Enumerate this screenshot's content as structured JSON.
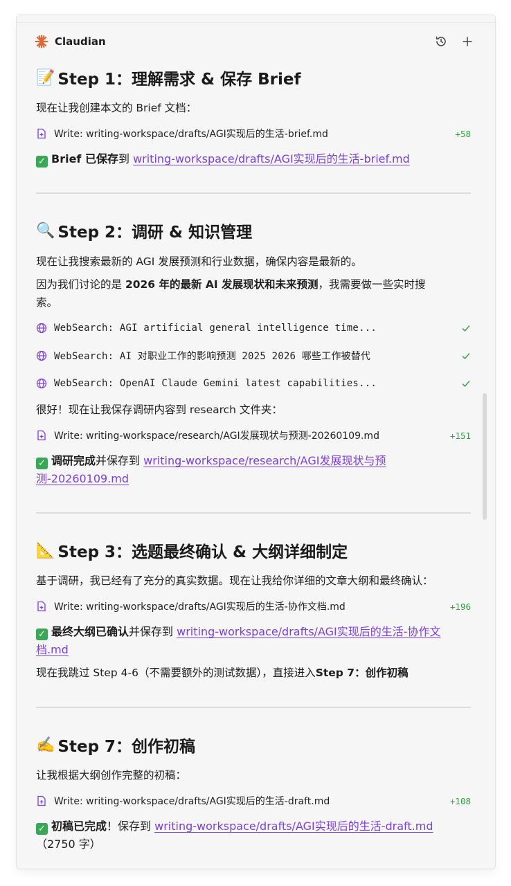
{
  "app": {
    "title": "Claudian"
  },
  "colors": {
    "accent_link": "#7b3fd6",
    "success": "#2fa043",
    "brand": "#d96a3b"
  },
  "icons": {
    "brand": "sunburst-icon",
    "history": "history-icon",
    "new": "plus-icon",
    "write": "file-plus-icon",
    "search": "globe-icon",
    "success": "check-icon"
  },
  "step1": {
    "emoji": "📝",
    "heading": "Step 1：理解需求 & 保存 Brief",
    "intro": "现在让我创建本文的 Brief 文档：",
    "tool": {
      "label": "Write: writing-workspace/drafts/AGI实现后的生活-brief.md",
      "stat": "+58"
    },
    "done_bold": "Brief 已保存",
    "done_text": "到 ",
    "done_link": "writing-workspace/drafts/AGI实现后的生活-brief.md"
  },
  "step2": {
    "emoji": "🔍",
    "heading": "Step 2：调研 & 知识管理",
    "intro": "现在让我搜索最新的 AGI 发展预测和行业数据，确保内容是最新的。",
    "para2_pre": "因为我们讨论的是 ",
    "para2_bold": "2026 年的最新 AI 发展现状和未来预测",
    "para2_post": "，我需要做一些实时搜",
    "para2_line2": "索。",
    "searches": [
      {
        "label": "WebSearch: AGI artificial general intelligence time..."
      },
      {
        "label": "WebSearch: AI 对职业工作的影响预测 2025 2026 哪些工作被替代"
      },
      {
        "label": "WebSearch: OpenAI Claude Gemini latest capabilities..."
      }
    ],
    "save_text": "很好！现在让我保存调研内容到 research 文件夹：",
    "tool": {
      "label": "Write: writing-workspace/research/AGI发展现状与预测-20260109.md",
      "stat": "+151"
    },
    "done_bold": "调研完成",
    "done_text": "并保存到 ",
    "done_link_line1": "writing-workspace/research/AGI发展现状与预",
    "done_link_line2": "测-20260109.md"
  },
  "step3": {
    "emoji": "📐",
    "heading": "Step 3：选题最终确认 & 大纲详细制定",
    "intro": "基于调研，我已经有了充分的真实数据。现在让我给你详细的文章大纲和最终确认：",
    "tool": {
      "label": "Write: writing-workspace/drafts/AGI实现后的生活-协作文档.md",
      "stat": "+196"
    },
    "done_bold": "最终大纲已确认",
    "done_text": "并保存到 ",
    "done_link_line1": "writing-workspace/drafts/AGI实现后的生活-协作文",
    "done_link_line2": "档.md",
    "skip_pre": "现在我跳过 Step 4-6（不需要额外的测试数据），直接进入",
    "skip_bold": "Step 7：创作初稿"
  },
  "step7": {
    "emoji": "✍️",
    "heading": "Step 7：创作初稿",
    "intro": "让我根据大纲创作完整的初稿：",
    "tool": {
      "label": "Write: writing-workspace/drafts/AGI实现后的生活-draft.md",
      "stat": "+108"
    },
    "done_bold": "初稿已完成",
    "done_text": "！保存到 ",
    "done_link": "writing-workspace/drafts/AGI实现后的生活-draft.md",
    "done_tail": "（2750 字）"
  }
}
